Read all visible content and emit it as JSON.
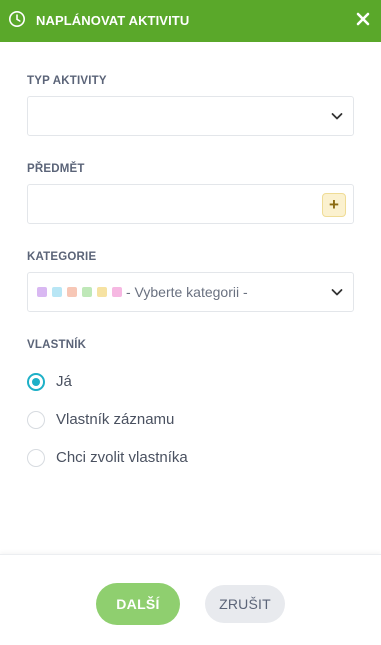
{
  "dialog": {
    "title": "NAPLÁNOVAT AKTIVITU",
    "header_color": "#5aa82a"
  },
  "activity_type": {
    "label": "TYP AKTIVITY",
    "value": ""
  },
  "subject": {
    "label": "PŘEDMĚT",
    "value": "",
    "add_label": "+"
  },
  "category": {
    "label": "KATEGORIE",
    "placeholder": "- Vyberte kategorii -",
    "swatch_colors": [
      "#d9b8f2",
      "#b8e6f5",
      "#f7c7b6",
      "#bfe8b8",
      "#f6e2a2",
      "#f6b8e2"
    ]
  },
  "owner": {
    "label": "VLASTNÍK",
    "options": [
      {
        "label": "Já",
        "selected": true
      },
      {
        "label": "Vlastník záznamu",
        "selected": false
      },
      {
        "label": "Chci zvolit vlastníka",
        "selected": false
      }
    ]
  },
  "footer": {
    "next_label": "DALŠÍ",
    "cancel_label": "ZRUŠIT"
  }
}
